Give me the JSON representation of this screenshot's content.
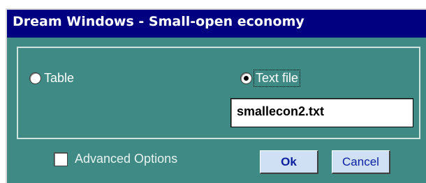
{
  "window": {
    "title": "Dream Windows - Small-open economy"
  },
  "source": {
    "options": [
      {
        "label": "Table",
        "selected": false
      },
      {
        "label": "Text file",
        "selected": true
      }
    ],
    "filename": "smallecon2.txt"
  },
  "advanced": {
    "label": "Advanced Options",
    "checked": false
  },
  "buttons": {
    "ok": "Ok",
    "cancel": "Cancel"
  },
  "colors": {
    "titlebar": "#000080",
    "background": "#3f8a84",
    "button": "#cfe0f4"
  }
}
